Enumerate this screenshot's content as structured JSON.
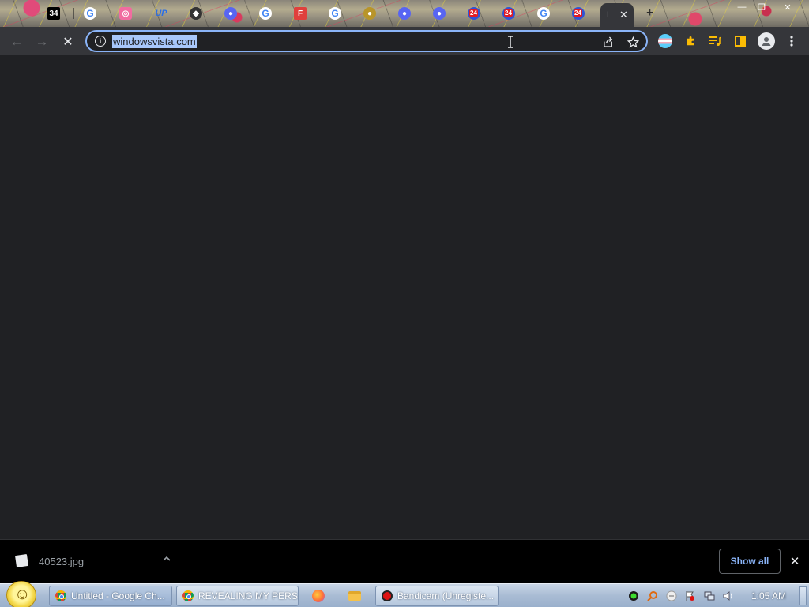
{
  "browser": {
    "tabs": [
      {
        "icon": "tab-34-icon",
        "label": "34"
      },
      {
        "icon": "google-icon",
        "label": "G"
      },
      {
        "icon": "pink-app-icon",
        "label": "◎"
      },
      {
        "icon": "up-icon",
        "label": "UP"
      },
      {
        "icon": "game-icon",
        "label": "◆"
      },
      {
        "icon": "discord-icon",
        "label": "●"
      },
      {
        "icon": "google-icon",
        "label": "G"
      },
      {
        "icon": "flipboard-icon",
        "label": "F"
      },
      {
        "icon": "google-icon",
        "label": "G"
      },
      {
        "icon": "gold-icon",
        "label": "●"
      },
      {
        "icon": "discord-icon",
        "label": "●"
      },
      {
        "icon": "discord-icon",
        "label": "●"
      },
      {
        "icon": "news24-icon",
        "label": "24"
      },
      {
        "icon": "news24-icon",
        "label": "24"
      },
      {
        "icon": "google-icon",
        "label": "G"
      },
      {
        "icon": "news24-icon",
        "label": "24"
      }
    ],
    "active_tab": {
      "title": "L",
      "close": "✕"
    },
    "new_tab": "+",
    "window_controls": {
      "minimize": "—",
      "maximize": "❐",
      "close": "✕"
    },
    "omnibox": {
      "url": "windowsvista.com",
      "info_glyph": "i"
    },
    "nav": {
      "back": "←",
      "forward": "→",
      "stop": "✕"
    }
  },
  "download_bar": {
    "file_name": "40523.jpg",
    "show_all": "Show all",
    "close": "✕"
  },
  "taskbar": {
    "buttons": [
      {
        "label": "Untitled - Google Ch...",
        "icon": "chrome-icon"
      },
      {
        "label": "REVEALING MY PERS...",
        "icon": "chrome-icon"
      },
      {
        "label": "Bandicam (Unregiste...",
        "icon": "bandicam-icon"
      }
    ],
    "clock": "1:05 AM"
  },
  "colors": {
    "page_bg": "#202124",
    "toolbar_bg": "#35363a",
    "accent": "#8ab4f8",
    "selection": "#a8c7fa"
  }
}
